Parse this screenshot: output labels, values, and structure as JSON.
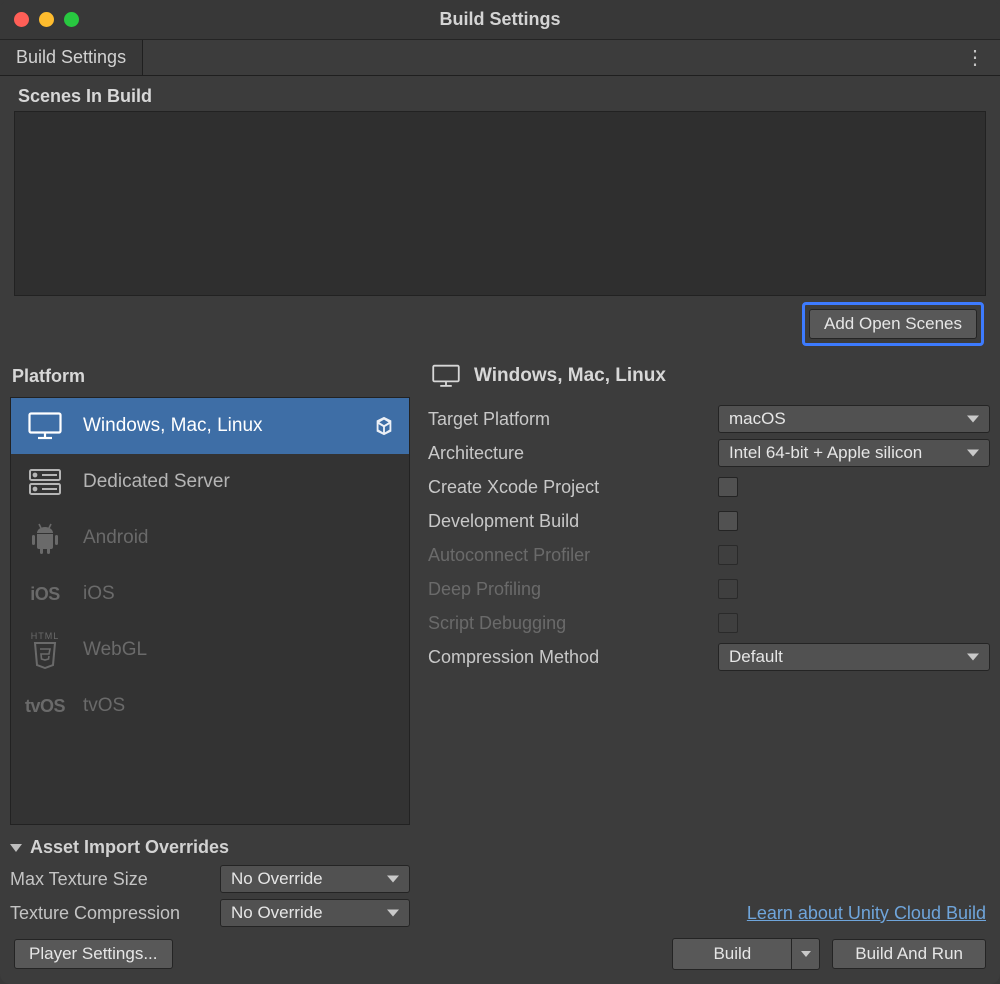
{
  "window": {
    "title": "Build Settings"
  },
  "tab": {
    "label": "Build Settings"
  },
  "scenes": {
    "header": "Scenes In Build",
    "add_button": "Add Open Scenes"
  },
  "platform": {
    "header": "Platform",
    "items": [
      {
        "label": "Windows, Mac, Linux"
      },
      {
        "label": "Dedicated Server"
      },
      {
        "label": "Android"
      },
      {
        "label": "iOS"
      },
      {
        "label": "WebGL"
      },
      {
        "label": "tvOS"
      }
    ]
  },
  "details": {
    "header": "Windows, Mac, Linux",
    "target_platform": {
      "label": "Target Platform",
      "value": "macOS"
    },
    "architecture": {
      "label": "Architecture",
      "value": "Intel 64-bit + Apple silicon"
    },
    "create_xcode": {
      "label": "Create Xcode Project"
    },
    "dev_build": {
      "label": "Development Build"
    },
    "autoconnect": {
      "label": "Autoconnect Profiler"
    },
    "deep_profiling": {
      "label": "Deep Profiling"
    },
    "script_debug": {
      "label": "Script Debugging"
    },
    "compression": {
      "label": "Compression Method",
      "value": "Default"
    },
    "cloud_link": "Learn about Unity Cloud Build"
  },
  "asset_overrides": {
    "header": "Asset Import Overrides",
    "max_texture": {
      "label": "Max Texture Size",
      "value": "No Override"
    },
    "tex_compression": {
      "label": "Texture Compression",
      "value": "No Override"
    }
  },
  "footer": {
    "player_settings": "Player Settings...",
    "build": "Build",
    "build_and_run": "Build And Run"
  }
}
